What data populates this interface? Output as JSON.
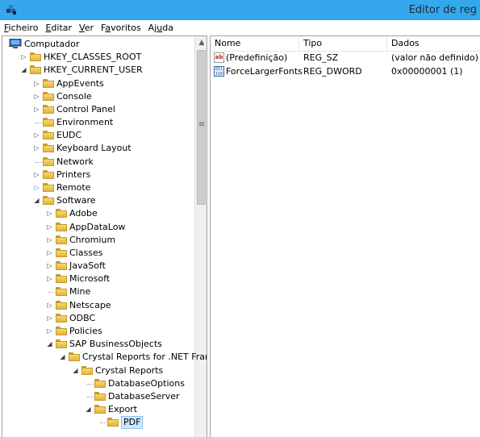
{
  "window": {
    "title": "Editor de reg"
  },
  "menu": [
    {
      "pre": "",
      "ul": "F",
      "post": "icheiro"
    },
    {
      "pre": "",
      "ul": "E",
      "post": "ditar"
    },
    {
      "pre": "",
      "ul": "V",
      "post": "er"
    },
    {
      "pre": "F",
      "ul": "a",
      "post": "voritos"
    },
    {
      "pre": "Aj",
      "ul": "u",
      "post": "da"
    }
  ],
  "tree": [
    {
      "label": "Computador",
      "level": 0,
      "toggle": "collapse",
      "icon": "computer-icon"
    },
    {
      "label": "HKEY_CLASSES_ROOT",
      "level": 1,
      "toggle": "expand",
      "icon": "folder-icon"
    },
    {
      "label": "HKEY_CURRENT_USER",
      "level": 1,
      "toggle": "collapse",
      "icon": "folder-icon"
    },
    {
      "label": "AppEvents",
      "level": 2,
      "toggle": "expand",
      "icon": "folder-icon"
    },
    {
      "label": "Console",
      "level": 2,
      "toggle": "expand",
      "icon": "folder-icon"
    },
    {
      "label": "Control Panel",
      "level": 2,
      "toggle": "expand",
      "icon": "folder-icon"
    },
    {
      "label": "Environment",
      "level": 2,
      "toggle": "none",
      "icon": "folder-icon"
    },
    {
      "label": "EUDC",
      "level": 2,
      "toggle": "expand",
      "icon": "folder-icon"
    },
    {
      "label": "Keyboard Layout",
      "level": 2,
      "toggle": "expand",
      "icon": "folder-icon"
    },
    {
      "label": "Network",
      "level": 2,
      "toggle": "none",
      "icon": "folder-icon"
    },
    {
      "label": "Printers",
      "level": 2,
      "toggle": "expand",
      "icon": "folder-icon"
    },
    {
      "label": "Remote",
      "level": 2,
      "toggle": "expand-blue",
      "icon": "folder-icon"
    },
    {
      "label": "Software",
      "level": 2,
      "toggle": "collapse",
      "icon": "folder-icon"
    },
    {
      "label": "Adobe",
      "level": 3,
      "toggle": "expand",
      "icon": "folder-icon"
    },
    {
      "label": "AppDataLow",
      "level": 3,
      "toggle": "expand",
      "icon": "folder-icon"
    },
    {
      "label": "Chromium",
      "level": 3,
      "toggle": "expand",
      "icon": "folder-icon"
    },
    {
      "label": "Classes",
      "level": 3,
      "toggle": "expand",
      "icon": "folder-icon"
    },
    {
      "label": "JavaSoft",
      "level": 3,
      "toggle": "expand",
      "icon": "folder-icon"
    },
    {
      "label": "Microsoft",
      "level": 3,
      "toggle": "expand",
      "icon": "folder-icon"
    },
    {
      "label": "Mine",
      "level": 3,
      "toggle": "none",
      "icon": "folder-icon"
    },
    {
      "label": "Netscape",
      "level": 3,
      "toggle": "expand",
      "icon": "folder-icon"
    },
    {
      "label": "ODBC",
      "level": 3,
      "toggle": "expand",
      "icon": "folder-icon"
    },
    {
      "label": "Policies",
      "level": 3,
      "toggle": "expand",
      "icon": "folder-icon"
    },
    {
      "label": "SAP BusinessObjects",
      "level": 3,
      "toggle": "collapse",
      "icon": "folder-icon"
    },
    {
      "label": "Crystal Reports for .NET Fram",
      "level": 4,
      "toggle": "collapse",
      "icon": "folder-icon"
    },
    {
      "label": "Crystal Reports",
      "level": 5,
      "toggle": "collapse",
      "icon": "folder-icon"
    },
    {
      "label": "DatabaseOptions",
      "level": 6,
      "toggle": "none",
      "icon": "folder-icon"
    },
    {
      "label": "DatabaseServer",
      "level": 6,
      "toggle": "none",
      "icon": "folder-icon"
    },
    {
      "label": "Export",
      "level": 6,
      "toggle": "collapse",
      "icon": "folder-icon"
    },
    {
      "label": "PDF",
      "level": 7,
      "toggle": "none",
      "icon": "folder-icon",
      "selected": true
    }
  ],
  "list": {
    "columns": [
      "Nome",
      "Tipo",
      "Dados"
    ],
    "rows": [
      {
        "icon": "string-value-icon",
        "icon_text": "ab",
        "name": "(Predefinição)",
        "type": "REG_SZ",
        "data": "(valor não definido)"
      },
      {
        "icon": "dword-value-icon",
        "icon_text": "011 110",
        "name": "ForceLargerFonts",
        "type": "REG_DWORD",
        "data": "0x00000001 (1)"
      }
    ]
  }
}
